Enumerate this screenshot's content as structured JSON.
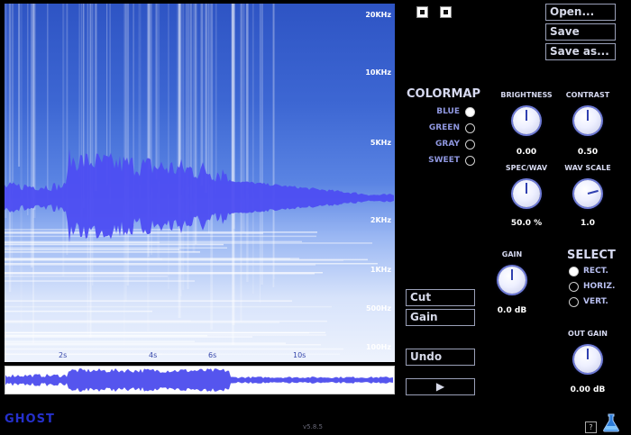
{
  "spectrogram": {
    "freq_labels": [
      "20KHz",
      "10KHz",
      "5KHz",
      "2KHz",
      "1KHz",
      "500Hz",
      "100Hz"
    ],
    "time_labels": [
      "2s",
      "4s",
      "6s",
      "10s"
    ]
  },
  "transport": {
    "stop_icon": "stop-square-icon",
    "pause_icon": "square-icon"
  },
  "file": {
    "open_label": "Open...",
    "save_label": "Save",
    "save_as_label": "Save as..."
  },
  "colormap": {
    "title": "COLORMAP",
    "options": [
      "BLUE",
      "GREEN",
      "GRAY",
      "SWEET"
    ],
    "selected": "BLUE"
  },
  "knobs": {
    "brightness": {
      "label": "BRIGHTNESS",
      "value": "0.00"
    },
    "contrast": {
      "label": "CONTRAST",
      "value": "0.50"
    },
    "spec_wav": {
      "label": "SPEC/WAV",
      "value": "50.0 %"
    },
    "wav_scale": {
      "label": "WAV SCALE",
      "value": "1.0"
    },
    "gain": {
      "label": "GAIN",
      "value": "0.0 dB"
    },
    "out_gain": {
      "label": "OUT GAIN",
      "value": "0.00 dB"
    }
  },
  "edit": {
    "cut_label": "Cut",
    "gain_label": "Gain",
    "undo_label": "Undo",
    "play_label": "▶"
  },
  "select": {
    "title": "SELECT",
    "options": [
      "RECT.",
      "HORIZ.",
      "VERT."
    ],
    "selected": "RECT."
  },
  "footer": {
    "logo": "GHOST",
    "version": "v5.8.5",
    "help": "?"
  },
  "colors": {
    "accent": "#5a5cf0",
    "background": "#000000"
  }
}
